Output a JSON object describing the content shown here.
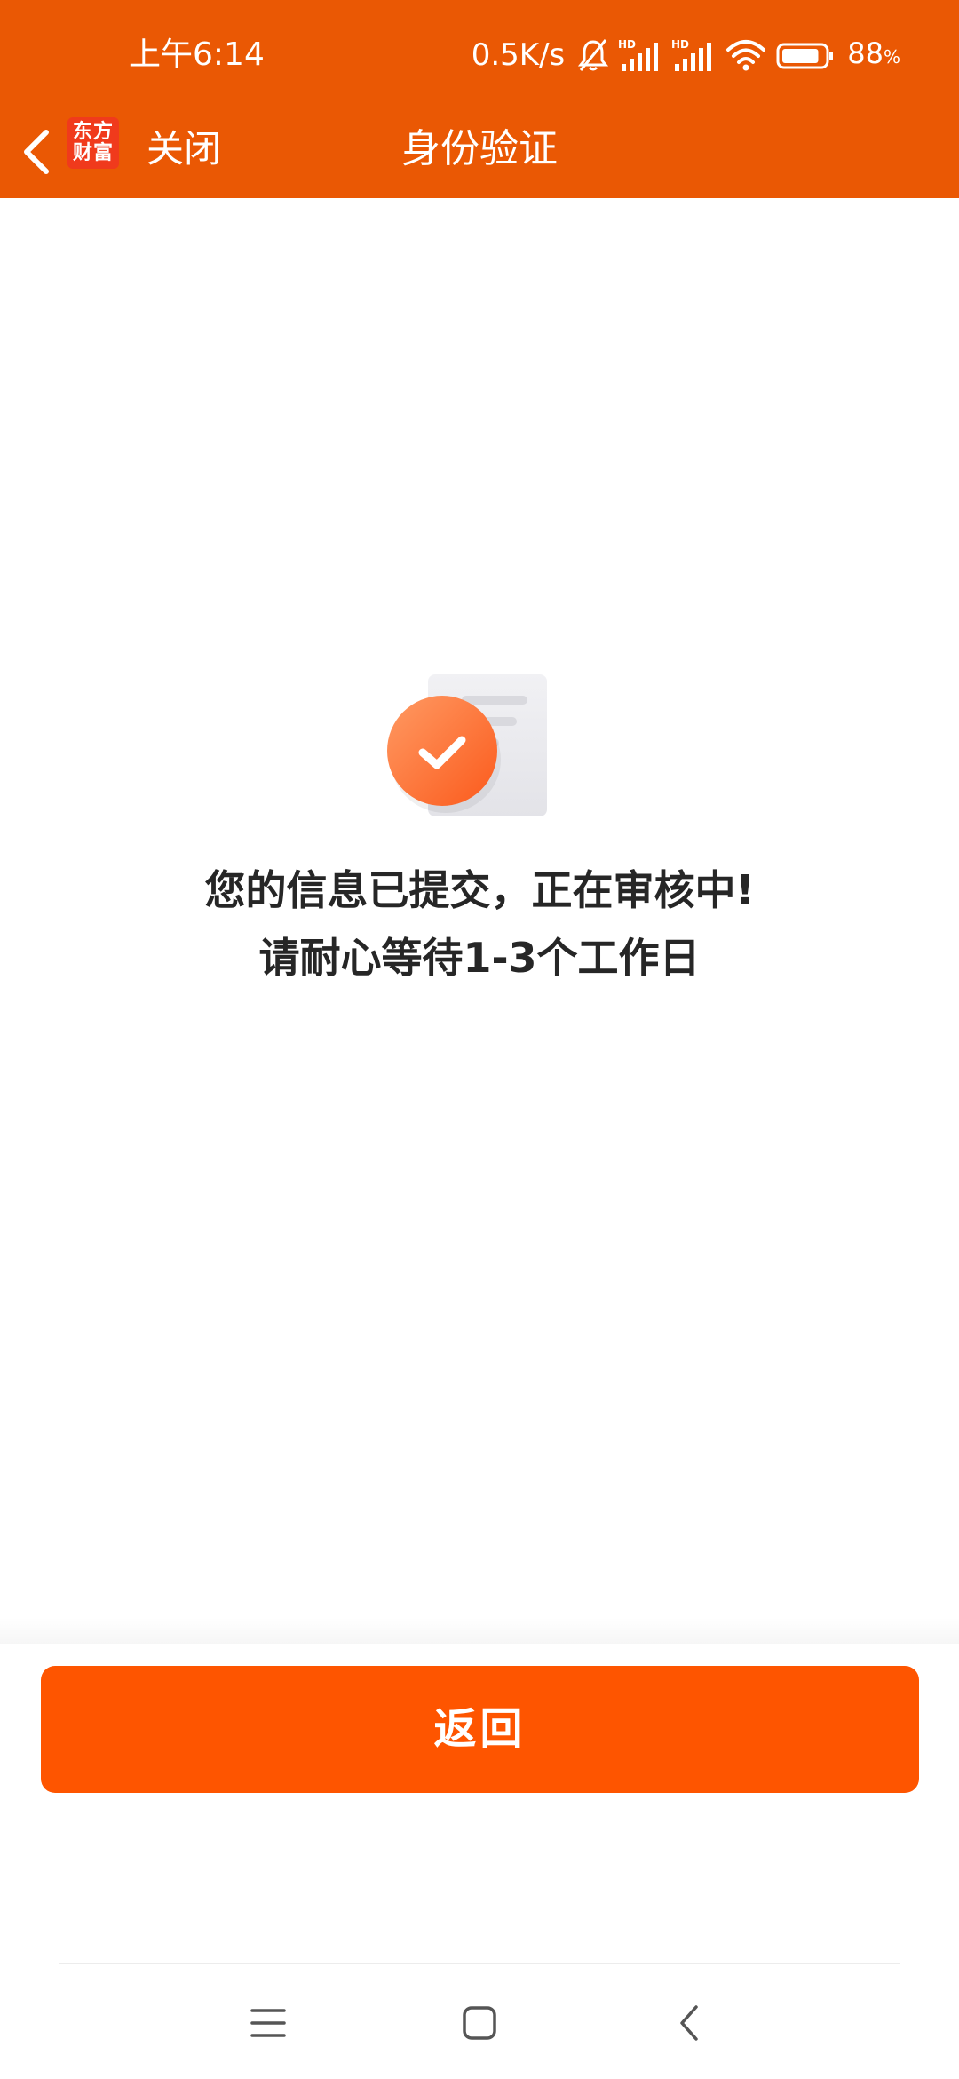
{
  "status_bar": {
    "time": "上午6:14",
    "net_speed": "0.5K/s",
    "battery_percent": "88",
    "battery_unit": "%",
    "battery_level": 0.88,
    "icons": [
      "mute-bell-icon",
      "hd-signal-icon",
      "hd-signal-icon",
      "wifi-icon",
      "battery-icon"
    ]
  },
  "nav": {
    "back_icon": "chevron-left-icon",
    "logo_line1": "东方",
    "logo_line2": "财富",
    "close_label": "关闭",
    "title": "身份验证"
  },
  "content": {
    "illustration_icon": "document-check-icon",
    "message_line1": "您的信息已提交，正在审核中!",
    "message_line2": "请耐心等待1-3个工作日"
  },
  "actions": {
    "return_label": "返回"
  },
  "system_nav": {
    "menu_icon": "menu-icon",
    "home_icon": "home-square-icon",
    "back_icon": "back-triangle-icon"
  },
  "colors": {
    "header_bg": "#ea5804",
    "button_bg": "#fe5500",
    "logo_bg": "#f03a1c",
    "text_primary": "#262626"
  }
}
